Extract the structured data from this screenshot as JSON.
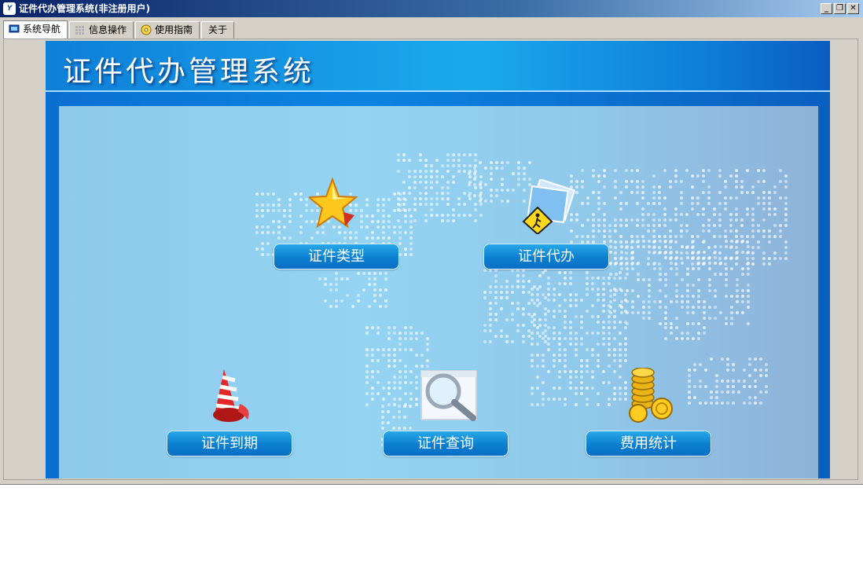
{
  "window": {
    "icon": "app-logo-icon",
    "title": "证件代办管理系统(非注册用户)",
    "controls": [
      "minimize-icon",
      "restore-icon",
      "close-icon"
    ]
  },
  "tabs": [
    {
      "label": "系统导航",
      "icon": "monitor-icon",
      "active": true
    },
    {
      "label": "信息操作",
      "icon": "grid-icon",
      "active": false
    },
    {
      "label": "使用指南",
      "icon": "help-disc-icon",
      "active": false
    },
    {
      "label": "关于",
      "icon": "",
      "active": false
    }
  ],
  "header": {
    "title": "证件代办管理系统"
  },
  "functions": [
    {
      "label": "证件类型",
      "icon": "star-icon"
    },
    {
      "label": "证件代办",
      "icon": "documents-pedestrian-icon"
    },
    {
      "label": "证件到期",
      "icon": "alarm-bell-icon"
    },
    {
      "label": "证件查询",
      "icon": "magnifier-icon"
    },
    {
      "label": "费用统计",
      "icon": "gold-coins-icon"
    }
  ],
  "colors": {
    "accent": "#0b84e0",
    "map": "#94d3f2",
    "button": "#0c7fd0"
  }
}
